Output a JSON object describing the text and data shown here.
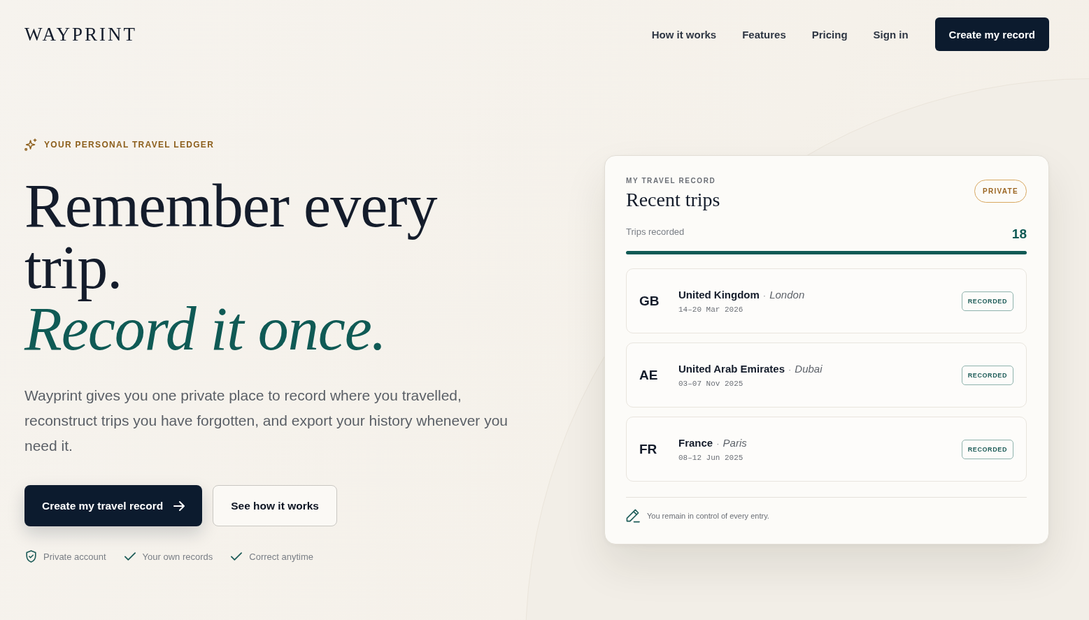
{
  "header": {
    "logo": "WAYPRINT",
    "nav": [
      "How it works",
      "Features",
      "Pricing",
      "Sign in"
    ],
    "cta": "Create my record"
  },
  "hero": {
    "eyebrow": "YOUR PERSONAL TRAVEL LEDGER",
    "headline": "Remember every trip.",
    "headline_accent": "Record it once.",
    "description": "Wayprint gives you one private place to record where you travelled, reconstruct trips you have forgotten, and export your history whenever you need it.",
    "primary_button": "Create my travel record",
    "secondary_button": "See how it works",
    "assurances": [
      {
        "kind": "shield",
        "label": "Private account"
      },
      {
        "kind": "check",
        "label": "Your own records"
      },
      {
        "kind": "check",
        "label": "Correct anytime"
      }
    ]
  },
  "record_card": {
    "eyebrow": "MY TRAVEL RECORD",
    "title": "Recent trips",
    "badge": "PRIVATE",
    "stat": {
      "label": "Trips recorded",
      "value": "18"
    },
    "trips": [
      {
        "code": "GB",
        "country": "United Kingdom",
        "separator": "·",
        "city": "London",
        "dates": "14–20 Mar 2026",
        "status": "RECORDED"
      },
      {
        "code": "AE",
        "country": "United Arab Emirates",
        "separator": "·",
        "city": "Dubai",
        "dates": "03–07 Nov 2025",
        "status": "RECORDED"
      },
      {
        "code": "FR",
        "country": "France",
        "separator": "·",
        "city": "Paris",
        "dates": "08–12 Jun 2025",
        "status": "RECORDED"
      }
    ],
    "footer": "You remain in control of every entry."
  }
}
